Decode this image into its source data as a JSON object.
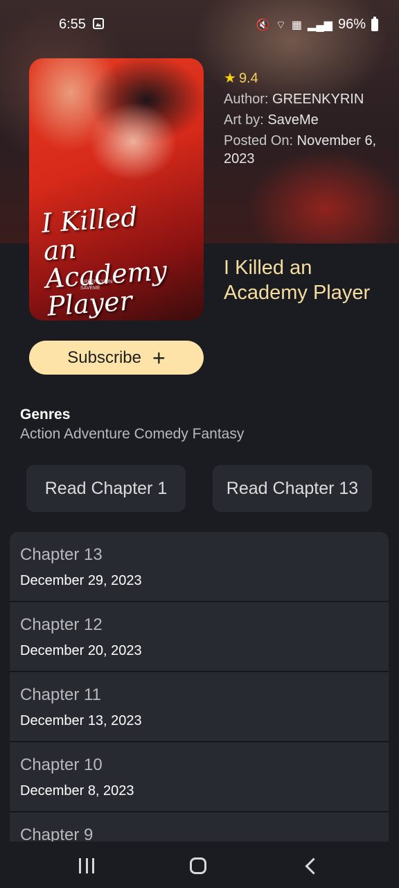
{
  "status_bar": {
    "time": "6:55",
    "battery": "96%",
    "icons": [
      "gallery-icon",
      "mute-icon",
      "wifi-icon",
      "volte-icon",
      "signal-icon",
      "battery-icon"
    ]
  },
  "cover": {
    "title_text": "I Killed an Academy Player",
    "credits": [
      "GREENKYRIN",
      "SAVEME"
    ],
    "watermark": "ASURASCANS.COM"
  },
  "meta": {
    "rating": "9.4",
    "author_label": "Author:",
    "author": "GREENKYRIN",
    "art_label": "Art by:",
    "artist": "SaveMe",
    "posted_label": "Posted On:",
    "posted_date": "November 6, 2023"
  },
  "title": "I Killed an Academy Player",
  "subscribe_label": "Subscribe",
  "genres": {
    "heading": "Genres",
    "list": "Action Adventure Comedy Fantasy"
  },
  "read_buttons": {
    "first": "Read Chapter 1",
    "latest": "Read Chapter 13"
  },
  "chapters": [
    {
      "name": "Chapter 13",
      "date": "December 29, 2023"
    },
    {
      "name": "Chapter 12",
      "date": "December 20, 2023"
    },
    {
      "name": "Chapter 11",
      "date": "December 13, 2023"
    },
    {
      "name": "Chapter 10",
      "date": "December 8, 2023"
    },
    {
      "name": "Chapter 9",
      "date": ""
    }
  ],
  "colors": {
    "accent": "#fde3a7",
    "title": "#f6dea0",
    "background": "#1b1c21",
    "card": "#272a31",
    "star": "#f6d21b"
  }
}
